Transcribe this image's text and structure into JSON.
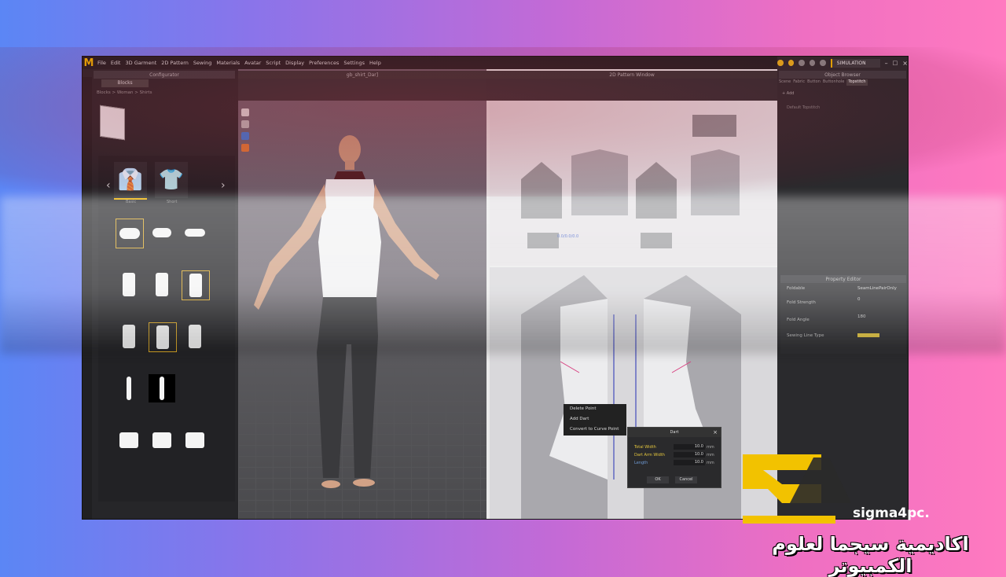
{
  "app": {
    "logo": "M",
    "menu": [
      "File",
      "Edit",
      "3D Garment",
      "2D Pattern",
      "Sewing",
      "Materials",
      "Avatar",
      "Script",
      "Display",
      "Preferences",
      "Settings",
      "Help"
    ],
    "mode_badge": "SIMULATION",
    "accent": "#f0b400"
  },
  "left_panel": {
    "header": "Configurator",
    "tab": "Blocks",
    "breadcrumb": "Blocks > Woman > Shirts",
    "carousel": [
      {
        "label": "Basic",
        "selected": true
      },
      {
        "label": "Short",
        "selected": false
      }
    ],
    "part_rows": 6
  },
  "viewport3d": {
    "file_tab": "gb_shirt_Dar]"
  },
  "viewport2d": {
    "header": "2D Pattern Window",
    "measure_label": "0.0/0.0/0.0"
  },
  "object_browser": {
    "header": "Object Browser",
    "tabs": [
      "Scene",
      "Fabric",
      "Button",
      "Buttonhole",
      "Topstitch"
    ],
    "add_label": "+ Add",
    "item": "Default Topstitch"
  },
  "property_editor": {
    "header": "Property Editor",
    "rows": [
      {
        "label": "Foldable",
        "value": "SeamLinePairOnly"
      },
      {
        "label": "Fold Strength",
        "value": "0"
      },
      {
        "label": "Fold Angle",
        "value": "180"
      },
      {
        "label": "Sewing Line Type",
        "value": ""
      }
    ]
  },
  "context_menu": {
    "items": [
      "Delete Point",
      "Add Dart",
      "Convert to Curve Point"
    ]
  },
  "dart_dialog": {
    "title": "Dart",
    "fields": [
      {
        "label": "Total Width",
        "value": "10.0",
        "unit": "mm"
      },
      {
        "label": "Dart Arm Width",
        "value": "10.0",
        "unit": "mm"
      },
      {
        "label": "Length",
        "value": "10.0",
        "unit": "mm"
      }
    ],
    "ok": "OK",
    "cancel": "Cancel"
  },
  "branding": {
    "site": "sigma4pc.",
    "arabic": "اكاديمية سيجما لعلوم الكمبيوتر",
    "logo_color": "#f2c200"
  }
}
